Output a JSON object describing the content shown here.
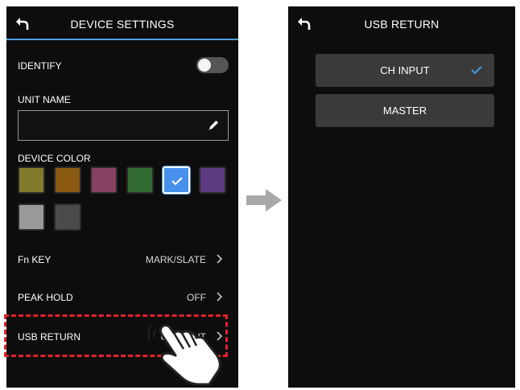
{
  "left_screen": {
    "title": "DEVICE SETTINGS",
    "identify_label": "IDENTIFY",
    "identify_on": false,
    "unit_name_label": "UNIT NAME",
    "unit_name_value": "",
    "device_color_label": "DEVICE COLOR",
    "colors": [
      {
        "name": "olive",
        "hex": "#807a2a"
      },
      {
        "name": "brown",
        "hex": "#8a5a12"
      },
      {
        "name": "magenta",
        "hex": "#874262"
      },
      {
        "name": "green",
        "hex": "#316b32"
      },
      {
        "name": "blue",
        "hex": "#4791ec",
        "selected": true
      },
      {
        "name": "purple",
        "hex": "#5e3a82"
      },
      {
        "name": "light-gray",
        "hex": "#9a9a9a"
      },
      {
        "name": "dark-gray",
        "hex": "#4a4a4a"
      }
    ],
    "fn_key_label": "Fn KEY",
    "fn_key_value": "MARK/SLATE",
    "peak_hold_label": "PEAK HOLD",
    "peak_hold_value": "OFF",
    "usb_return_label": "USB RETURN",
    "usb_return_value": "CH INPUT"
  },
  "right_screen": {
    "title": "USB RETURN",
    "options": [
      {
        "label": "CH INPUT",
        "selected": true
      },
      {
        "label": "MASTER",
        "selected": false
      }
    ]
  },
  "colors": {
    "accent": "#4d9de0",
    "highlight_dash": "#e2232a",
    "arrow": "#a8a8a8"
  },
  "icons": [
    "back-icon",
    "pencil-icon",
    "check-icon",
    "chevron-right-icon",
    "arrow-right-icon",
    "pointing-hand-icon"
  ]
}
